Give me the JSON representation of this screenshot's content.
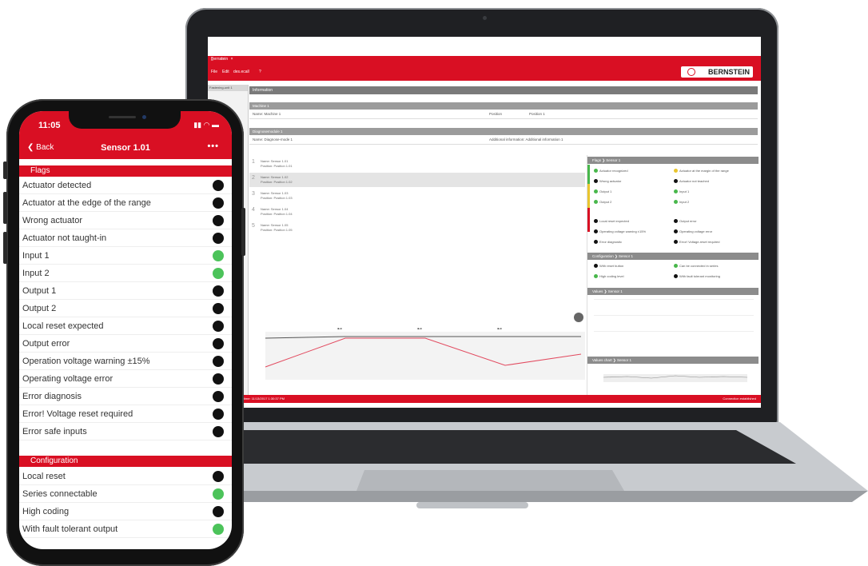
{
  "desktop": {
    "window_title": "Bernstein",
    "window_controls": "_ □ ×",
    "menu": [
      "File",
      "Edit",
      "des.ecall",
      "?"
    ],
    "brand_name": "BERNSTEIN",
    "sidebar_item": "Fastening-unit 1",
    "main_header": "Information",
    "sections": {
      "machine": "Machine 1",
      "diagnostics": "Diagnosemodule 1"
    },
    "machine_row": {
      "name": "Name: Machine 1",
      "position_label": "Position",
      "position_value": "Position 1"
    },
    "diagnostics_row": {
      "name": "Name: Diagnose-mode 1",
      "additional": "Additional information: Additional information 1"
    },
    "devices": [
      {
        "num": "1",
        "name": "Name: Sensor 1.01",
        "position": "Position: Position 1.01"
      },
      {
        "num": "2",
        "name": "Name: Sensor 1.02",
        "position": "Position: Position 1.02"
      },
      {
        "num": "3",
        "name": "Name: Sensor 1.03",
        "position": "Position: Position 1.03"
      },
      {
        "num": "4",
        "name": "Name: Sensor 1.04",
        "position": "Position: Position 1.04"
      },
      {
        "num": "5",
        "name": "Name: Sensor 1.05",
        "position": "Position: Position 1.05"
      }
    ],
    "right_panel": {
      "flags_header": "Flags ❯ Sensor 1",
      "flags": [
        {
          "label": "Actuator recognized",
          "state": "green"
        },
        {
          "label": "Actuator at the margin of the range",
          "state": "yellow"
        },
        {
          "label": "Wrong actuator",
          "state": "black"
        },
        {
          "label": "Actuator not teached",
          "state": "black"
        },
        {
          "label": "Output 1",
          "state": "green"
        },
        {
          "label": "Input 1",
          "state": "green"
        },
        {
          "label": "Output 2",
          "state": "green"
        },
        {
          "label": "Input 2",
          "state": "green"
        },
        {
          "label": "Local reset expected",
          "state": "black"
        },
        {
          "label": "Output error",
          "state": "black"
        },
        {
          "label": "Operating voltage warning ±15%",
          "state": "black"
        },
        {
          "label": "Operating voltage error",
          "state": "black"
        },
        {
          "label": "Error diagnostic",
          "state": "black"
        },
        {
          "label": "Error! Voltage-reset required",
          "state": "black"
        }
      ],
      "config_header": "Configuration ❯ Sensor 1",
      "config": [
        {
          "label": "With reset button",
          "state": "black"
        },
        {
          "label": "Can be connected in series",
          "state": "green"
        },
        {
          "label": "High coding level",
          "state": "green"
        },
        {
          "label": "With fault tolerant monitoring",
          "state": "black"
        }
      ],
      "values_header": "Values ❯ Sensor 1",
      "values_header2": "Values chart ❯ Sensor 1"
    },
    "status_bar": {
      "left": "2017 1:51:41 PM   Sent time: 11/13/2017 1:30:37 PM",
      "right": "Connection established"
    }
  },
  "phone": {
    "time": "11:05",
    "back_label": "Back",
    "title": "Sensor 1.01",
    "more_label": "•••",
    "flags_header": "Flags",
    "flags": [
      {
        "label": "Actuator detected",
        "on": false
      },
      {
        "label": "Actuator at the edge of the range",
        "on": false
      },
      {
        "label": "Wrong actuator",
        "on": false
      },
      {
        "label": "Actuator not taught-in",
        "on": false
      },
      {
        "label": "Input 1",
        "on": true
      },
      {
        "label": "Input 2",
        "on": true
      },
      {
        "label": "Output 1",
        "on": false
      },
      {
        "label": "Output 2",
        "on": false
      },
      {
        "label": "Local reset expected",
        "on": false
      },
      {
        "label": "Output error",
        "on": false
      },
      {
        "label": "Operation voltage warning ±15%",
        "on": false
      },
      {
        "label": "Operating voltage error",
        "on": false
      },
      {
        "label": "Error diagnosis",
        "on": false
      },
      {
        "label": "Error! Voltage reset required",
        "on": false
      },
      {
        "label": "Error safe inputs",
        "on": false
      }
    ],
    "config_header": "Configuration",
    "config": [
      {
        "label": "Local reset",
        "on": false
      },
      {
        "label": "Series connectable",
        "on": true
      },
      {
        "label": "High coding",
        "on": false
      },
      {
        "label": "With fault tolerant output",
        "on": true
      }
    ]
  },
  "colors": {
    "brand_red": "#d90f23",
    "status_green": "#4cc35a",
    "status_off": "#111111"
  }
}
